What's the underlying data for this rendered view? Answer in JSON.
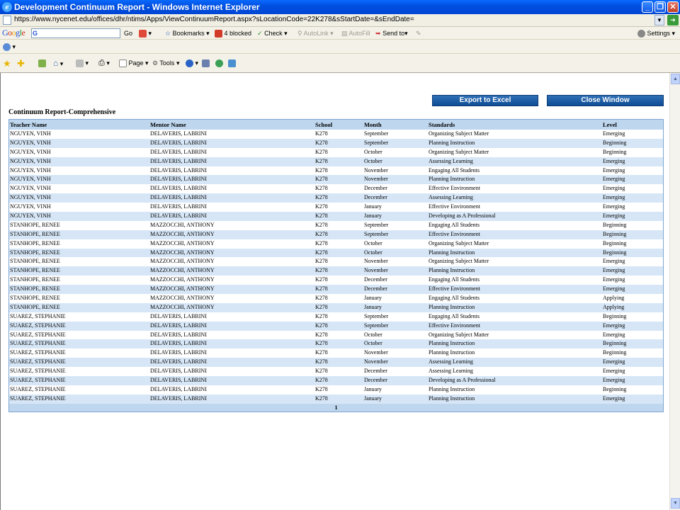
{
  "window": {
    "title": "Development Continuum Report - Windows Internet Explorer",
    "min_label": "_",
    "max_label": "❐",
    "close_label": "✕"
  },
  "address": {
    "url": "https://www.nycenet.edu/offices/dhr/ntims/Apps/ViewContinuumReport.aspx?sLocationCode=22K278&sStartDate=&sEndDate="
  },
  "google_toolbar": {
    "go_label": "Go",
    "bookmarks_label": "Bookmarks",
    "blocked_label": "4 blocked",
    "check_label": "Check",
    "autolink_label": "AutoLink",
    "autofill_label": "AutoFill",
    "sendto_label": "Send to",
    "settings_label": "Settings"
  },
  "command_bar": {
    "page_label": "Page",
    "tools_label": "Tools"
  },
  "actions": {
    "export_label": "Export to Excel",
    "close_label": "Close Window"
  },
  "report": {
    "title": "Continuum Report-Comprehensive",
    "columns": {
      "teacher": "Teacher Name",
      "mentor": "Mentor Name",
      "school": "School",
      "month": "Month",
      "standards": "Standards",
      "level": "Level"
    },
    "rows": [
      {
        "teacher": "NGUYEN, VINH",
        "mentor": "DELAVERIS, LABRINI",
        "school": "K278",
        "month": "September",
        "standards": "Organizing Subject Matter",
        "level": "Emerging"
      },
      {
        "teacher": "NGUYEN, VINH",
        "mentor": "DELAVERIS, LABRINI",
        "school": "K278",
        "month": "September",
        "standards": "Planning Instruction",
        "level": "Beginning"
      },
      {
        "teacher": "NGUYEN, VINH",
        "mentor": "DELAVERIS, LABRINI",
        "school": "K278",
        "month": "October",
        "standards": "Organizing Subject Matter",
        "level": "Beginning"
      },
      {
        "teacher": "NGUYEN, VINH",
        "mentor": "DELAVERIS, LABRINI",
        "school": "K278",
        "month": "October",
        "standards": "Assessing Learning",
        "level": "Emerging"
      },
      {
        "teacher": "NGUYEN, VINH",
        "mentor": "DELAVERIS, LABRINI",
        "school": "K278",
        "month": "November",
        "standards": "Engaging All Students",
        "level": "Emerging"
      },
      {
        "teacher": "NGUYEN, VINH",
        "mentor": "DELAVERIS, LABRINI",
        "school": "K278",
        "month": "November",
        "standards": "Planning Instruction",
        "level": "Emerging"
      },
      {
        "teacher": "NGUYEN, VINH",
        "mentor": "DELAVERIS, LABRINI",
        "school": "K278",
        "month": "December",
        "standards": "Effective Environment",
        "level": "Emerging"
      },
      {
        "teacher": "NGUYEN, VINH",
        "mentor": "DELAVERIS, LABRINI",
        "school": "K278",
        "month": "December",
        "standards": "Assessing Learning",
        "level": "Emerging"
      },
      {
        "teacher": "NGUYEN, VINH",
        "mentor": "DELAVERIS, LABRINI",
        "school": "K278",
        "month": "January",
        "standards": "Effective Environment",
        "level": "Emerging"
      },
      {
        "teacher": "NGUYEN, VINH",
        "mentor": "DELAVERIS, LABRINI",
        "school": "K278",
        "month": "January",
        "standards": "Developing as A Professional",
        "level": "Emerging"
      },
      {
        "teacher": "STANHOPE, RENEE",
        "mentor": "MAZZOCCHI, ANTHONY",
        "school": "K278",
        "month": "September",
        "standards": "Engaging All Students",
        "level": "Beginning"
      },
      {
        "teacher": "STANHOPE, RENEE",
        "mentor": "MAZZOCCHI, ANTHONY",
        "school": "K278",
        "month": "September",
        "standards": "Effective Environment",
        "level": "Beginning"
      },
      {
        "teacher": "STANHOPE, RENEE",
        "mentor": "MAZZOCCHI, ANTHONY",
        "school": "K278",
        "month": "October",
        "standards": "Organizing Subject Matter",
        "level": "Beginning"
      },
      {
        "teacher": "STANHOPE, RENEE",
        "mentor": "MAZZOCCHI, ANTHONY",
        "school": "K278",
        "month": "October",
        "standards": "Planning Instruction",
        "level": "Beginning"
      },
      {
        "teacher": "STANHOPE, RENEE",
        "mentor": "MAZZOCCHI, ANTHONY",
        "school": "K278",
        "month": "November",
        "standards": "Organizing Subject Matter",
        "level": "Emerging"
      },
      {
        "teacher": "STANHOPE, RENEE",
        "mentor": "MAZZOCCHI, ANTHONY",
        "school": "K278",
        "month": "November",
        "standards": "Planning Instruction",
        "level": "Emerging"
      },
      {
        "teacher": "STANHOPE, RENEE",
        "mentor": "MAZZOCCHI, ANTHONY",
        "school": "K278",
        "month": "December",
        "standards": "Engaging All Students",
        "level": "Emerging"
      },
      {
        "teacher": "STANHOPE, RENEE",
        "mentor": "MAZZOCCHI, ANTHONY",
        "school": "K278",
        "month": "December",
        "standards": "Effective Environment",
        "level": "Emerging"
      },
      {
        "teacher": "STANHOPE, RENEE",
        "mentor": "MAZZOCCHI, ANTHONY",
        "school": "K278",
        "month": "January",
        "standards": "Engaging All Students",
        "level": "Applying"
      },
      {
        "teacher": "STANHOPE, RENEE",
        "mentor": "MAZZOCCHI, ANTHONY",
        "school": "K278",
        "month": "January",
        "standards": "Planning Instruction",
        "level": "Applying"
      },
      {
        "teacher": "SUAREZ, STEPHANIE",
        "mentor": "DELAVERIS, LABRINI",
        "school": "K278",
        "month": "September",
        "standards": "Engaging All Students",
        "level": "Beginning"
      },
      {
        "teacher": "SUAREZ, STEPHANIE",
        "mentor": "DELAVERIS, LABRINI",
        "school": "K278",
        "month": "September",
        "standards": "Effective Environment",
        "level": "Emerging"
      },
      {
        "teacher": "SUAREZ, STEPHANIE",
        "mentor": "DELAVERIS, LABRINI",
        "school": "K278",
        "month": "October",
        "standards": "Organizing Subject Matter",
        "level": "Emerging"
      },
      {
        "teacher": "SUAREZ, STEPHANIE",
        "mentor": "DELAVERIS, LABRINI",
        "school": "K278",
        "month": "October",
        "standards": "Planning Instruction",
        "level": "Beginning"
      },
      {
        "teacher": "SUAREZ, STEPHANIE",
        "mentor": "DELAVERIS, LABRINI",
        "school": "K278",
        "month": "November",
        "standards": "Planning Instruction",
        "level": "Beginning"
      },
      {
        "teacher": "SUAREZ, STEPHANIE",
        "mentor": "DELAVERIS, LABRINI",
        "school": "K278",
        "month": "November",
        "standards": "Assessing Learning",
        "level": "Emerging"
      },
      {
        "teacher": "SUAREZ, STEPHANIE",
        "mentor": "DELAVERIS, LABRINI",
        "school": "K278",
        "month": "December",
        "standards": "Assessing Learning",
        "level": "Emerging"
      },
      {
        "teacher": "SUAREZ, STEPHANIE",
        "mentor": "DELAVERIS, LABRINI",
        "school": "K278",
        "month": "December",
        "standards": "Developing as A Professional",
        "level": "Emerging"
      },
      {
        "teacher": "SUAREZ, STEPHANIE",
        "mentor": "DELAVERIS, LABRINI",
        "school": "K278",
        "month": "January",
        "standards": "Planning Instruction",
        "level": "Beginning"
      },
      {
        "teacher": "SUAREZ, STEPHANIE",
        "mentor": "DELAVERIS, LABRINI",
        "school": "K278",
        "month": "January",
        "standards": "Planning Instruction",
        "level": "Emerging"
      }
    ],
    "pager": "1"
  },
  "colors": {
    "header_row": "#bed7ef",
    "alt_row": "#d6e6f6",
    "button": "#1a5aa3"
  },
  "icons": [
    "ie-logo-icon",
    "page-icon",
    "star-icon",
    "add-favorite-icon",
    "home-icon",
    "rss-icon",
    "print-icon",
    "page-icon",
    "gear-icon",
    "help-icon"
  ]
}
